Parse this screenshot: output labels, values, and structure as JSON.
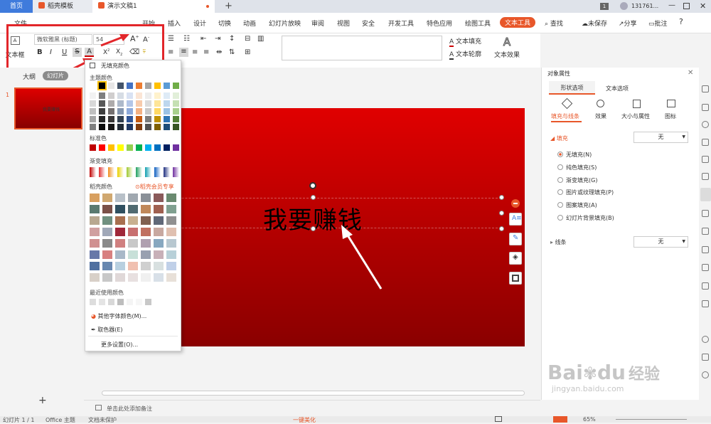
{
  "tabs": [
    {
      "label": "首页"
    },
    {
      "label": "稻壳模板"
    },
    {
      "label": "演示文稿1"
    }
  ],
  "tabbar": {
    "badge": "1",
    "user": "131761..."
  },
  "menu": {
    "items": [
      "文件",
      "开始",
      "插入",
      "设计",
      "切换",
      "动画",
      "幻灯片放映",
      "审阅",
      "视图",
      "安全",
      "开发工具",
      "特色应用",
      "绘图工具",
      "文本工具"
    ],
    "search": "查找",
    "unsaved": "未保存",
    "share": "分享",
    "comment": "批注",
    "help": "?"
  },
  "ribbon": {
    "textbox": "文本框",
    "font_family": "微软雅黑 (标题)",
    "font_size": "54",
    "text_fill": "文本填充",
    "text_outline": "文本轮廓",
    "text_effect": "文本效果"
  },
  "left_tabs": {
    "outline": "大纲",
    "slides": "幻灯片"
  },
  "thumb": {
    "number": "1",
    "title": "我要赚钱"
  },
  "slide": {
    "title": "我要赚钱"
  },
  "dropdown": {
    "no_fill": "无填充颜色",
    "theme_colors": "主题颜色",
    "standard_colors": "标准色",
    "gradient_fill": "渐变填充",
    "docer_colors": "稻壳颜色",
    "docer_vip": "稻壳会员专享",
    "recent_colors": "最近使用颜色",
    "more_colors": "其他字体颜色(M)...",
    "eyedropper": "取色器(E)",
    "more_settings": "更多设置(O)..."
  },
  "panel": {
    "title": "对象属性",
    "tab_shape": "形状选项",
    "tab_text": "文本选项",
    "sub_fill_line": "填充与线条",
    "sub_effect": "效果",
    "sub_size": "大小与属性",
    "sub_picture": "图标",
    "fill_section": "填充",
    "fill_value": "无",
    "fill_options": [
      "无填充(N)",
      "纯色填充(S)",
      "渐变填充(G)",
      "图片或纹理填充(P)",
      "图案填充(A)",
      "幻灯片背景填充(B)"
    ],
    "line_section": "线条",
    "line_value": "无"
  },
  "notes": {
    "placeholder": "单击此处添加备注"
  },
  "status": {
    "slide_info": "幻灯片 1 / 1",
    "theme": "Office 主题",
    "protect": "文档未保护",
    "beautify": "一键美化",
    "zoom": "65%"
  },
  "watermark": {
    "brand": "Bai",
    "brand2": "du",
    "brand3": "经验",
    "url": "jingyan.baidu.com"
  },
  "colors": {
    "accent": "#e8572a",
    "tab_blue": "#3f7bdc",
    "slide_red": "#e00000",
    "annotation": "#e2262a"
  }
}
